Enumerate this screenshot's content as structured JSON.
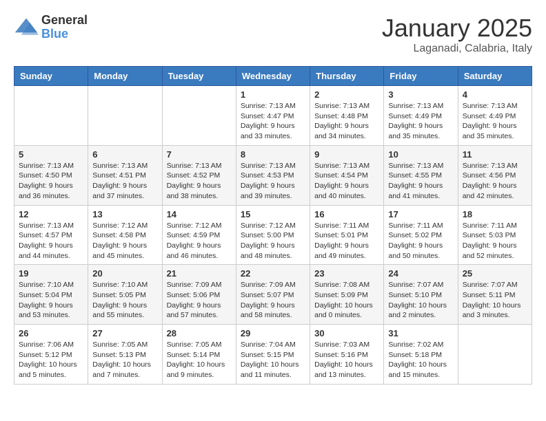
{
  "logo": {
    "general": "General",
    "blue": "Blue"
  },
  "header": {
    "month": "January 2025",
    "location": "Laganadi, Calabria, Italy"
  },
  "weekdays": [
    "Sunday",
    "Monday",
    "Tuesday",
    "Wednesday",
    "Thursday",
    "Friday",
    "Saturday"
  ],
  "weeks": [
    [
      {
        "day": "",
        "info": ""
      },
      {
        "day": "",
        "info": ""
      },
      {
        "day": "",
        "info": ""
      },
      {
        "day": "1",
        "info": "Sunrise: 7:13 AM\nSunset: 4:47 PM\nDaylight: 9 hours\nand 33 minutes."
      },
      {
        "day": "2",
        "info": "Sunrise: 7:13 AM\nSunset: 4:48 PM\nDaylight: 9 hours\nand 34 minutes."
      },
      {
        "day": "3",
        "info": "Sunrise: 7:13 AM\nSunset: 4:49 PM\nDaylight: 9 hours\nand 35 minutes."
      },
      {
        "day": "4",
        "info": "Sunrise: 7:13 AM\nSunset: 4:49 PM\nDaylight: 9 hours\nand 35 minutes."
      }
    ],
    [
      {
        "day": "5",
        "info": "Sunrise: 7:13 AM\nSunset: 4:50 PM\nDaylight: 9 hours\nand 36 minutes."
      },
      {
        "day": "6",
        "info": "Sunrise: 7:13 AM\nSunset: 4:51 PM\nDaylight: 9 hours\nand 37 minutes."
      },
      {
        "day": "7",
        "info": "Sunrise: 7:13 AM\nSunset: 4:52 PM\nDaylight: 9 hours\nand 38 minutes."
      },
      {
        "day": "8",
        "info": "Sunrise: 7:13 AM\nSunset: 4:53 PM\nDaylight: 9 hours\nand 39 minutes."
      },
      {
        "day": "9",
        "info": "Sunrise: 7:13 AM\nSunset: 4:54 PM\nDaylight: 9 hours\nand 40 minutes."
      },
      {
        "day": "10",
        "info": "Sunrise: 7:13 AM\nSunset: 4:55 PM\nDaylight: 9 hours\nand 41 minutes."
      },
      {
        "day": "11",
        "info": "Sunrise: 7:13 AM\nSunset: 4:56 PM\nDaylight: 9 hours\nand 42 minutes."
      }
    ],
    [
      {
        "day": "12",
        "info": "Sunrise: 7:13 AM\nSunset: 4:57 PM\nDaylight: 9 hours\nand 44 minutes."
      },
      {
        "day": "13",
        "info": "Sunrise: 7:12 AM\nSunset: 4:58 PM\nDaylight: 9 hours\nand 45 minutes."
      },
      {
        "day": "14",
        "info": "Sunrise: 7:12 AM\nSunset: 4:59 PM\nDaylight: 9 hours\nand 46 minutes."
      },
      {
        "day": "15",
        "info": "Sunrise: 7:12 AM\nSunset: 5:00 PM\nDaylight: 9 hours\nand 48 minutes."
      },
      {
        "day": "16",
        "info": "Sunrise: 7:11 AM\nSunset: 5:01 PM\nDaylight: 9 hours\nand 49 minutes."
      },
      {
        "day": "17",
        "info": "Sunrise: 7:11 AM\nSunset: 5:02 PM\nDaylight: 9 hours\nand 50 minutes."
      },
      {
        "day": "18",
        "info": "Sunrise: 7:11 AM\nSunset: 5:03 PM\nDaylight: 9 hours\nand 52 minutes."
      }
    ],
    [
      {
        "day": "19",
        "info": "Sunrise: 7:10 AM\nSunset: 5:04 PM\nDaylight: 9 hours\nand 53 minutes."
      },
      {
        "day": "20",
        "info": "Sunrise: 7:10 AM\nSunset: 5:05 PM\nDaylight: 9 hours\nand 55 minutes."
      },
      {
        "day": "21",
        "info": "Sunrise: 7:09 AM\nSunset: 5:06 PM\nDaylight: 9 hours\nand 57 minutes."
      },
      {
        "day": "22",
        "info": "Sunrise: 7:09 AM\nSunset: 5:07 PM\nDaylight: 9 hours\nand 58 minutes."
      },
      {
        "day": "23",
        "info": "Sunrise: 7:08 AM\nSunset: 5:09 PM\nDaylight: 10 hours\nand 0 minutes."
      },
      {
        "day": "24",
        "info": "Sunrise: 7:07 AM\nSunset: 5:10 PM\nDaylight: 10 hours\nand 2 minutes."
      },
      {
        "day": "25",
        "info": "Sunrise: 7:07 AM\nSunset: 5:11 PM\nDaylight: 10 hours\nand 3 minutes."
      }
    ],
    [
      {
        "day": "26",
        "info": "Sunrise: 7:06 AM\nSunset: 5:12 PM\nDaylight: 10 hours\nand 5 minutes."
      },
      {
        "day": "27",
        "info": "Sunrise: 7:05 AM\nSunset: 5:13 PM\nDaylight: 10 hours\nand 7 minutes."
      },
      {
        "day": "28",
        "info": "Sunrise: 7:05 AM\nSunset: 5:14 PM\nDaylight: 10 hours\nand 9 minutes."
      },
      {
        "day": "29",
        "info": "Sunrise: 7:04 AM\nSunset: 5:15 PM\nDaylight: 10 hours\nand 11 minutes."
      },
      {
        "day": "30",
        "info": "Sunrise: 7:03 AM\nSunset: 5:16 PM\nDaylight: 10 hours\nand 13 minutes."
      },
      {
        "day": "31",
        "info": "Sunrise: 7:02 AM\nSunset: 5:18 PM\nDaylight: 10 hours\nand 15 minutes."
      },
      {
        "day": "",
        "info": ""
      }
    ]
  ]
}
